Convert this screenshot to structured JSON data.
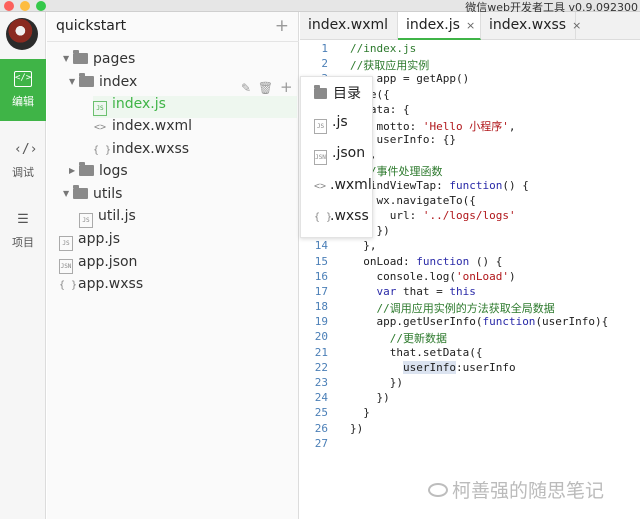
{
  "window": {
    "title": "微信web开发者工具 v0.9.092300",
    "traffic_colors": [
      "#fc605b",
      "#fdbc40",
      "#34c84a"
    ]
  },
  "rail": {
    "items": [
      {
        "label": "编辑",
        "icon": "code-bracket-icon",
        "glyph": "</>",
        "active": true
      },
      {
        "label": "调试",
        "icon": "debug-icon",
        "glyph": "‹/›",
        "active": false
      },
      {
        "label": "项目",
        "icon": "menu-list-icon",
        "glyph": "☰",
        "active": false
      }
    ]
  },
  "tree": {
    "project_name": "quickstart",
    "add_symbol": "+",
    "nodes": [
      {
        "label": "pages",
        "type": "folder",
        "expanded": true
      },
      {
        "label": "index",
        "type": "folder",
        "expanded": true
      },
      {
        "label": "index.js",
        "type": "js",
        "icon_text": "JS",
        "selected": true
      },
      {
        "label": "index.wxml",
        "type": "wxml",
        "icon_text": "<>"
      },
      {
        "label": "index.wxss",
        "type": "wxss",
        "icon_text": "{ }"
      },
      {
        "label": "logs",
        "type": "folder",
        "expanded": false
      },
      {
        "label": "utils",
        "type": "folder",
        "expanded": true
      },
      {
        "label": "util.js",
        "type": "js",
        "icon_text": "JS"
      },
      {
        "label": "app.js",
        "type": "js",
        "icon_text": "JS"
      },
      {
        "label": "app.json",
        "type": "json",
        "icon_text": "JSN"
      },
      {
        "label": "app.wxss",
        "type": "wxss",
        "icon_text": "{ }"
      }
    ],
    "row_actions": [
      "✎",
      "🗑",
      "+"
    ]
  },
  "popup_menu": {
    "items": [
      {
        "label": "目录",
        "icon": "folder-icon",
        "icon_text": ""
      },
      {
        "label": ".js",
        "icon": "js-file-icon",
        "icon_text": "JS"
      },
      {
        "label": ".json",
        "icon": "json-file-icon",
        "icon_text": "JSN"
      },
      {
        "label": ".wxml",
        "icon": "wxml-file-icon",
        "icon_text": "<>"
      },
      {
        "label": ".wxss",
        "icon": "wxss-file-icon",
        "icon_text": "{ }"
      }
    ]
  },
  "tabs": [
    {
      "label": "index.wxml",
      "active": false,
      "closable": false
    },
    {
      "label": "index.js",
      "active": true,
      "closable": true
    },
    {
      "label": "index.wxss",
      "active": false,
      "closable": true
    }
  ],
  "close_symbol": "×",
  "code_lines": [
    [
      {
        "t": "//index.js",
        "c": "cmt"
      }
    ],
    [
      {
        "t": "//获取应用实例",
        "c": "cmt"
      }
    ],
    [
      {
        "t": "var app = getApp()",
        "c": ""
      }
    ],
    [
      {
        "t": "Page({",
        "c": ""
      }
    ],
    [
      {
        "t": "  data: {",
        "c": ""
      }
    ],
    [
      {
        "t": "    motto: ",
        "c": ""
      },
      {
        "t": "'Hello 小程序'",
        "c": "str"
      },
      {
        "t": ",",
        "c": ""
      }
    ],
    [
      {
        "t": "    userInfo: {}",
        "c": ""
      }
    ],
    [
      {
        "t": "  },",
        "c": ""
      }
    ],
    [
      {
        "t": "  //事件处理函数",
        "c": "cmt"
      }
    ],
    [
      {
        "t": "  bindViewTap: ",
        "c": ""
      },
      {
        "t": "function",
        "c": "kw"
      },
      {
        "t": "() {",
        "c": ""
      }
    ],
    [
      {
        "t": "    wx.navigateTo({",
        "c": ""
      }
    ],
    [
      {
        "t": "      url: ",
        "c": ""
      },
      {
        "t": "'../logs/logs'",
        "c": "str"
      }
    ],
    [
      {
        "t": "    })",
        "c": ""
      }
    ],
    [
      {
        "t": "  },",
        "c": ""
      }
    ],
    [
      {
        "t": "  onLoad: ",
        "c": ""
      },
      {
        "t": "function",
        "c": "kw"
      },
      {
        "t": " () {",
        "c": ""
      }
    ],
    [
      {
        "t": "    console.log(",
        "c": ""
      },
      {
        "t": "'onLoad'",
        "c": "str"
      },
      {
        "t": ")",
        "c": ""
      }
    ],
    [
      {
        "t": "    ",
        "c": ""
      },
      {
        "t": "var",
        "c": "kw"
      },
      {
        "t": " that = ",
        "c": ""
      },
      {
        "t": "this",
        "c": "kw"
      }
    ],
    [
      {
        "t": "    //调用应用实例的方法获取全局数据",
        "c": "cmt"
      }
    ],
    [
      {
        "t": "    app.getUserInfo(",
        "c": ""
      },
      {
        "t": "function",
        "c": "kw"
      },
      {
        "t": "(userInfo){",
        "c": ""
      }
    ],
    [
      {
        "t": "      //更新数据",
        "c": "cmt"
      }
    ],
    [
      {
        "t": "      that.setData({",
        "c": ""
      }
    ],
    [
      {
        "t": "        ",
        "c": ""
      },
      {
        "t": "userInfo",
        "c": "hl"
      },
      {
        "t": ":userInfo",
        "c": ""
      }
    ],
    [
      {
        "t": "      })",
        "c": ""
      }
    ],
    [
      {
        "t": "    })",
        "c": ""
      }
    ],
    [
      {
        "t": "  }",
        "c": ""
      }
    ],
    [
      {
        "t": "})",
        "c": ""
      }
    ],
    [
      {
        "t": "",
        "c": ""
      }
    ]
  ],
  "watermark": "柯善强的随思笔记"
}
